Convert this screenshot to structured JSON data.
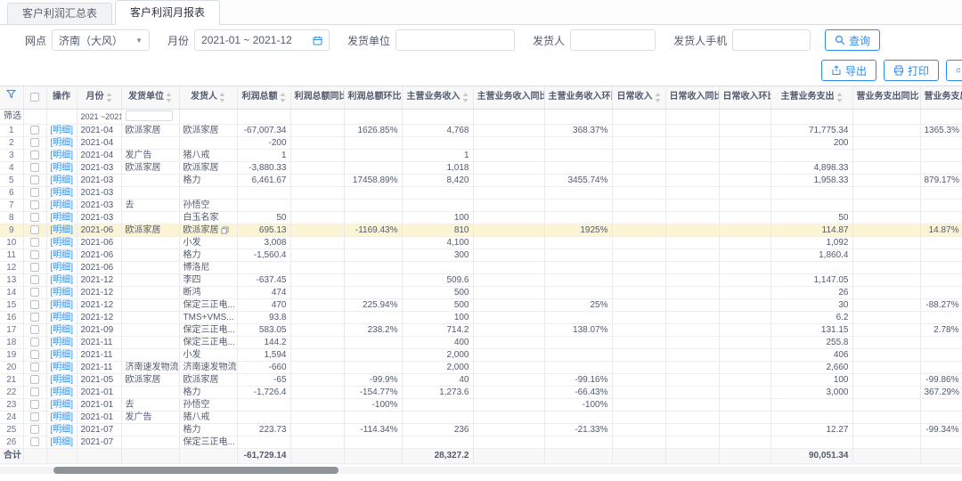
{
  "colors": {
    "accent": "#2d8cf0",
    "row_highlight": "#fbf5d6",
    "header_bg": "#f8f8f9"
  },
  "tabs": [
    {
      "label": "客户利润汇总表",
      "active": false
    },
    {
      "label": "客户利润月报表",
      "active": true
    }
  ],
  "filters": {
    "branch_label": "网点",
    "branch_value": "济南（大风）",
    "month_label": "月份",
    "month_value": "2021-01 ~ 2021-12",
    "ship_unit_label": "发货单位",
    "ship_unit_value": "",
    "shipper_label": "发货人",
    "shipper_value": "",
    "shipper_phone_label": "发货人手机",
    "shipper_phone_value": "",
    "query_button": "查询"
  },
  "toolbar": {
    "export_label": "导出",
    "print_label": "打印"
  },
  "table": {
    "action_label": "[明细]",
    "filter_row": {
      "label": "筛选",
      "month_value": "2021 ~2021"
    },
    "columns": [
      {
        "label": "操作",
        "sortable": false
      },
      {
        "label": "月份",
        "sortable": true
      },
      {
        "label": "发货单位",
        "sortable": true
      },
      {
        "label": "发货人",
        "sortable": true
      },
      {
        "label": "利润总额",
        "sortable": true
      },
      {
        "label": "利润总额同比",
        "sortable": true
      },
      {
        "label": "利润总额环比",
        "sortable": true
      },
      {
        "label": "主营业务收入",
        "sortable": true
      },
      {
        "label": "主营业务收入同比",
        "sortable": true
      },
      {
        "label": "主营业务收入环比",
        "sortable": true
      },
      {
        "label": "日常收入",
        "sortable": true
      },
      {
        "label": "日常收入同比",
        "sortable": true
      },
      {
        "label": "日常收入环比",
        "sortable": true
      },
      {
        "label": "主营业务支出",
        "sortable": true
      },
      {
        "label": "营业务支出同比",
        "sortable": false
      },
      {
        "label": "营业务支出环比",
        "sortable": false
      }
    ],
    "rows": [
      {
        "n": "1",
        "month": "2021-04",
        "unit": "欧派家居",
        "consignee": "欧派家居",
        "profit": "-67,007.34",
        "profit_mom": "1626.85%",
        "income": "4,768",
        "income_mom": "368.37%",
        "expense": "71,775.34",
        "expense_mom": "1365.3%"
      },
      {
        "n": "2",
        "month": "2021-04",
        "profit": "-200",
        "expense": "200"
      },
      {
        "n": "3",
        "month": "2021-04",
        "unit": "发广告",
        "consignee": "猪八戒",
        "profit": "1",
        "income": "1"
      },
      {
        "n": "4",
        "month": "2021-03",
        "unit": "欧派家居",
        "consignee": "欧派家居",
        "profit": "-3,880.33",
        "income": "1,018",
        "expense": "4,898.33"
      },
      {
        "n": "5",
        "month": "2021-03",
        "consignee": "格力",
        "profit": "6,461.67",
        "profit_mom": "17458.89%",
        "income": "8,420",
        "income_mom": "3455.74%",
        "expense": "1,958.33",
        "expense_mom": "879.17%"
      },
      {
        "n": "6",
        "month": "2021-03"
      },
      {
        "n": "7",
        "month": "2021-03",
        "unit": "去",
        "consignee": "孙悟空"
      },
      {
        "n": "8",
        "month": "2021-03",
        "consignee": "白玉名家",
        "profit": "50",
        "income": "100",
        "expense": "50"
      },
      {
        "n": "9",
        "month": "2021-06",
        "unit": "欧派家居",
        "consignee": "欧派家居",
        "copy": true,
        "highlight": true,
        "profit": "695.13",
        "profit_mom": "-1169.43%",
        "income": "810",
        "income_mom": "1925%",
        "expense": "114.87",
        "expense_mom": "14.87%"
      },
      {
        "n": "10",
        "month": "2021-06",
        "consignee": "小发",
        "profit": "3,008",
        "income": "4,100",
        "expense": "1,092"
      },
      {
        "n": "11",
        "month": "2021-06",
        "consignee": "格力",
        "profit": "-1,560.4",
        "income": "300",
        "expense": "1,860.4"
      },
      {
        "n": "12",
        "month": "2021-06",
        "consignee": "博洛尼"
      },
      {
        "n": "13",
        "month": "2021-12",
        "consignee": "李四",
        "profit": "-637.45",
        "income": "509.6",
        "expense": "1,147.05"
      },
      {
        "n": "14",
        "month": "2021-12",
        "consignee": "断鸿",
        "profit": "474",
        "income": "500",
        "expense": "26"
      },
      {
        "n": "15",
        "month": "2021-12",
        "consignee": "保定三正电...",
        "profit": "470",
        "profit_mom": "225.94%",
        "income": "500",
        "income_mom": "25%",
        "expense": "30",
        "expense_mom": "-88.27%"
      },
      {
        "n": "16",
        "month": "2021-12",
        "consignee": "TMS+VMS...",
        "profit": "93.8",
        "income": "100",
        "expense": "6.2"
      },
      {
        "n": "17",
        "month": "2021-09",
        "consignee": "保定三正电...",
        "profit": "583.05",
        "profit_mom": "238.2%",
        "income": "714.2",
        "income_mom": "138.07%",
        "expense": "131.15",
        "expense_mom": "2.78%"
      },
      {
        "n": "18",
        "month": "2021-11",
        "consignee": "保定三正电...",
        "profit": "144.2",
        "income": "400",
        "expense": "255.8"
      },
      {
        "n": "19",
        "month": "2021-11",
        "consignee": "小发",
        "profit": "1,594",
        "income": "2,000",
        "expense": "406"
      },
      {
        "n": "20",
        "month": "2021-11",
        "unit": "济南速发物流",
        "consignee": "济南速发物流",
        "profit": "-660",
        "income": "2,000",
        "expense": "2,660"
      },
      {
        "n": "21",
        "month": "2021-05",
        "unit": "欧派家居",
        "consignee": "欧派家居",
        "profit": "-65",
        "profit_mom": "-99.9%",
        "income": "40",
        "income_mom": "-99.16%",
        "expense": "100",
        "expense_mom": "-99.86%"
      },
      {
        "n": "22",
        "month": "2021-01",
        "consignee": "格力",
        "profit": "-1,726.4",
        "profit_mom": "-154.77%",
        "income": "1,273.6",
        "income_mom": "-66.43%",
        "expense": "3,000",
        "expense_mom": "367.29%"
      },
      {
        "n": "23",
        "month": "2021-01",
        "unit": "去",
        "consignee": "孙悟空",
        "profit_mom": "-100%",
        "income_mom": "-100%"
      },
      {
        "n": "24",
        "month": "2021-01",
        "unit": "发广告",
        "consignee": "猪八戒"
      },
      {
        "n": "25",
        "month": "2021-07",
        "consignee": "格力",
        "profit": "223.73",
        "profit_mom": "-114.34%",
        "income": "236",
        "income_mom": "-21.33%",
        "expense": "12.27",
        "expense_mom": "-99.34%"
      },
      {
        "n": "26",
        "month": "2021-07",
        "consignee": "保定三正电..."
      }
    ],
    "footer": {
      "label": "合计",
      "profit_total": "-61,729.14",
      "income_total": "28,327.2",
      "expense_total": "90,051.34"
    }
  }
}
